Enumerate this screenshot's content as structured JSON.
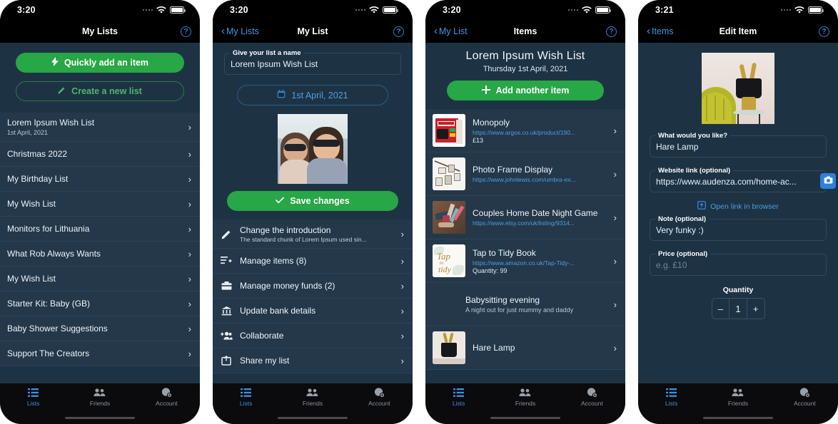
{
  "screens": [
    {
      "status": {
        "time": "3:20"
      },
      "nav": {
        "title": "My Lists",
        "back": null,
        "help": "?"
      },
      "actions": {
        "primary": "Quickly add an item",
        "secondary": "Create a new list"
      },
      "lists": [
        {
          "title": "Lorem Ipsum Wish List",
          "sub": "1st April, 2021"
        },
        {
          "title": "Christmas 2022",
          "sub": ""
        },
        {
          "title": "My Birthday List",
          "sub": ""
        },
        {
          "title": "My Wish List",
          "sub": ""
        },
        {
          "title": "Monitors for Lithuania",
          "sub": ""
        },
        {
          "title": "What Rob Always Wants",
          "sub": ""
        },
        {
          "title": "My Wish List",
          "sub": ""
        },
        {
          "title": "Starter Kit: Baby (GB)",
          "sub": ""
        },
        {
          "title": "Baby Shower Suggestions",
          "sub": ""
        },
        {
          "title": "Support The Creators",
          "sub": ""
        }
      ],
      "tabs": [
        {
          "label": "Lists",
          "icon": "list-icon",
          "active": true
        },
        {
          "label": "Friends",
          "icon": "people-icon",
          "active": false
        },
        {
          "label": "Account",
          "icon": "account-icon",
          "active": false
        }
      ]
    },
    {
      "status": {
        "time": "3:20"
      },
      "nav": {
        "title": "My List",
        "back": "My Lists",
        "help": "?"
      },
      "name_field": {
        "label": "Give your list a name",
        "value": "Lorem Ipsum Wish List"
      },
      "date_button": {
        "label": "1st April, 2021",
        "icon": "calendar-icon"
      },
      "photo_alt": "list-cover-photo",
      "save_button": "Save changes",
      "menu": [
        {
          "icon": "pencil-icon",
          "title": "Change the introduction",
          "sub": "The standard chunk of Lorem Ipsum used sin..."
        },
        {
          "icon": "list-add-icon",
          "title": "Manage items (8)",
          "sub": ""
        },
        {
          "icon": "wallet-icon",
          "title": "Manage money funds (2)",
          "sub": ""
        },
        {
          "icon": "bank-icon",
          "title": "Update bank details",
          "sub": ""
        },
        {
          "icon": "add-person-icon",
          "title": "Collaborate",
          "sub": ""
        },
        {
          "icon": "share-icon",
          "title": "Share my list",
          "sub": ""
        }
      ],
      "tabs": [
        {
          "label": "Lists",
          "icon": "list-icon",
          "active": true
        },
        {
          "label": "Friends",
          "icon": "people-icon",
          "active": false
        },
        {
          "label": "Account",
          "icon": "account-icon",
          "active": false
        }
      ]
    },
    {
      "status": {
        "time": "3:20"
      },
      "nav": {
        "title": "Items",
        "back": "My List",
        "help": "?"
      },
      "header": {
        "title": "Lorem Ipsum Wish List",
        "date": "Thursday 1st April, 2021"
      },
      "add_button": "Add another item",
      "items": [
        {
          "title": "Monopoly",
          "link": "https://www.argos.co.uk/product/190...",
          "meta": "£13",
          "thumb": "monopoly"
        },
        {
          "title": "Photo Frame Display",
          "link": "https://www.johnlewis.com/umbra-ex...",
          "meta": "",
          "thumb": "frames"
        },
        {
          "title": "Couples Home Date Night Game",
          "link": "https://www.etsy.com/uk/listing/9314...",
          "meta": "",
          "thumb": "datenight"
        },
        {
          "title": "Tap to Tidy Book",
          "link": "https://www.amazon.co.uk/Tap-Tidy-...",
          "meta": "Quantity: 99",
          "thumb": "taptotidy"
        },
        {
          "title": "Babysitting evening",
          "link": "",
          "meta": "A night out for just mummy and daddy",
          "thumb": "none"
        },
        {
          "title": "Hare Lamp",
          "link": "",
          "meta": "",
          "thumb": "harelamp"
        }
      ],
      "tabs": [
        {
          "label": "Lists",
          "icon": "list-icon",
          "active": true
        },
        {
          "label": "Friends",
          "icon": "people-icon",
          "active": false
        },
        {
          "label": "Account",
          "icon": "account-icon",
          "active": false
        }
      ]
    },
    {
      "status": {
        "time": "3:21"
      },
      "nav": {
        "title": "Edit Item",
        "back": "Items",
        "help": "?"
      },
      "photo_alt": "hare-lamp-photo",
      "fields": {
        "name": {
          "label": "What would you like?",
          "value": "Hare Lamp"
        },
        "link": {
          "label": "Website link (optional)",
          "value": "https://www.audenza.com/home-ac...",
          "camera_icon": "camera-icon"
        },
        "note": {
          "label": "Note (optional)",
          "value": "Very funky :)"
        },
        "price": {
          "label": "Price (optional)",
          "placeholder": "e.g. £10",
          "value": ""
        }
      },
      "open_link": "Open link in browser",
      "quantity": {
        "label": "Quantity",
        "value": "1",
        "minus": "–",
        "plus": "+"
      },
      "tabs": [
        {
          "label": "Lists",
          "icon": "list-icon",
          "active": true
        },
        {
          "label": "Friends",
          "icon": "people-icon",
          "active": false
        },
        {
          "label": "Account",
          "icon": "account-icon",
          "active": false
        }
      ]
    }
  ],
  "colors": {
    "background": "#1d3344",
    "row": "#24384a",
    "green": "#27a745",
    "blue": "#4b9ee0",
    "bar": "#000000"
  }
}
